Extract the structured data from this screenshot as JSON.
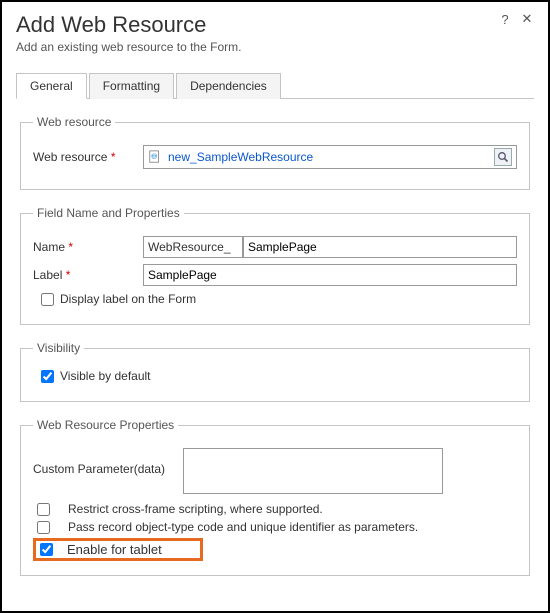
{
  "header": {
    "title": "Add Web Resource",
    "subtitle": "Add an existing web resource to the Form."
  },
  "tabs": {
    "general": "General",
    "formatting": "Formatting",
    "dependencies": "Dependencies"
  },
  "webResource": {
    "legend": "Web resource",
    "label": "Web resource",
    "value": "new_SampleWebResource"
  },
  "fieldNameProps": {
    "legend": "Field Name and Properties",
    "nameLabel": "Name",
    "namePrefix": "WebResource_",
    "nameValue": "SamplePage",
    "labelLabel": "Label",
    "labelValue": "SamplePage",
    "displayLabel": "Display label on the Form"
  },
  "visibility": {
    "legend": "Visibility",
    "visibleByDefault": "Visible by default"
  },
  "wrp": {
    "legend": "Web Resource Properties",
    "customParamLabel": "Custom Parameter(data)",
    "customParamValue": "",
    "restrict": "Restrict cross-frame scripting, where supported.",
    "passRecord": "Pass record object-type code and unique identifier as parameters.",
    "enableTablet": "Enable for tablet"
  }
}
